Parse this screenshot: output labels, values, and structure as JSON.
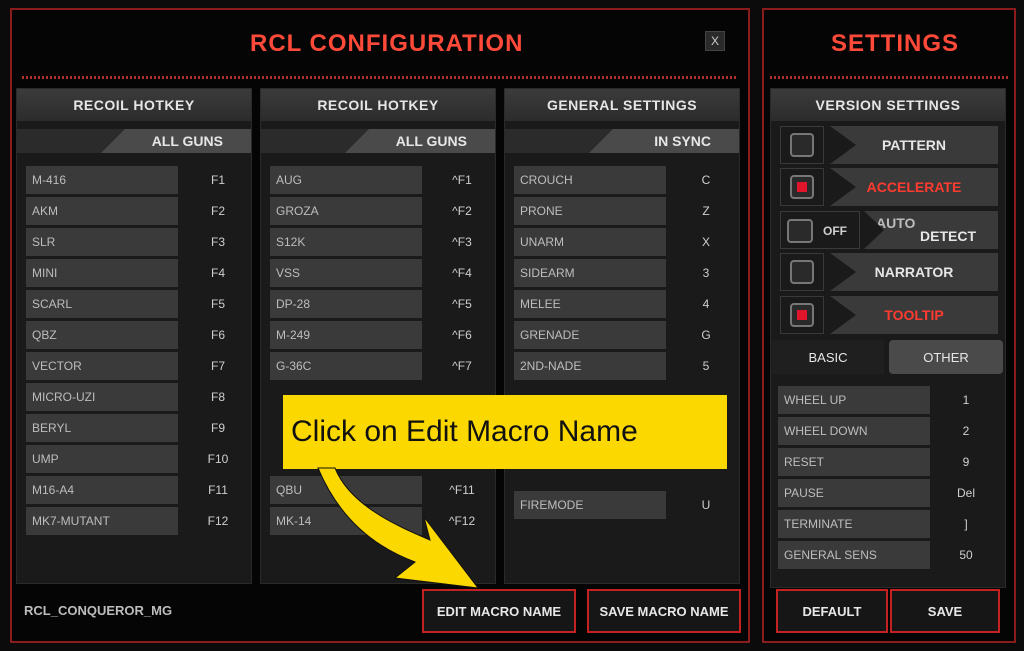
{
  "main": {
    "title": "RCL  CONFIGURATION",
    "close_label": "X",
    "profile_name": "RCL_CONQUEROR_MG",
    "edit_macro_label": "EDIT MACRO NAME",
    "save_macro_label": "SAVE MACRO NAME"
  },
  "col1": {
    "header": "RECOIL HOTKEY",
    "tab": "ALL GUNS",
    "rows": [
      {
        "name": "M-416",
        "key": "F1"
      },
      {
        "name": "AKM",
        "key": "F2"
      },
      {
        "name": "SLR",
        "key": "F3"
      },
      {
        "name": "MINI",
        "key": "F4"
      },
      {
        "name": "SCARL",
        "key": "F5"
      },
      {
        "name": "QBZ",
        "key": "F6"
      },
      {
        "name": "VECTOR",
        "key": "F7"
      },
      {
        "name": "MICRO-UZI",
        "key": "F8"
      },
      {
        "name": "BERYL",
        "key": "F9"
      },
      {
        "name": "UMP",
        "key": "F10"
      },
      {
        "name": "M16-A4",
        "key": "F11"
      },
      {
        "name": "MK7-MUTANT",
        "key": "F12"
      }
    ]
  },
  "col2": {
    "header": "RECOIL HOTKEY",
    "tab": "ALL GUNS",
    "rows": [
      {
        "name": "AUG",
        "key": "^F1"
      },
      {
        "name": "GROZA",
        "key": "^F2"
      },
      {
        "name": "S12K",
        "key": "^F3"
      },
      {
        "name": "VSS",
        "key": "^F4"
      },
      {
        "name": "DP-28",
        "key": "^F5"
      },
      {
        "name": "M-249",
        "key": "^F6"
      },
      {
        "name": "G-36C",
        "key": "^F7"
      },
      {
        "name": "QBU",
        "key": "^F11"
      },
      {
        "name": "MK-14",
        "key": "^F12"
      }
    ]
  },
  "col3": {
    "header": "GENERAL SETTINGS",
    "tab": "IN SYNC",
    "rows": [
      {
        "name": "CROUCH",
        "key": "C"
      },
      {
        "name": "PRONE",
        "key": "Z"
      },
      {
        "name": "UNARM",
        "key": "X"
      },
      {
        "name": "SIDEARM",
        "key": "3"
      },
      {
        "name": "MELEE",
        "key": "4"
      },
      {
        "name": "GRENADE",
        "key": "G"
      },
      {
        "name": "2ND-NADE",
        "key": "5"
      },
      {
        "name": "FIREMODE",
        "key": "U"
      }
    ]
  },
  "settings": {
    "title": "SETTINGS",
    "version_header": "VERSION SETTINGS",
    "pattern_label": "PATTERN",
    "accelerate_label": "ACCELERATE",
    "toggle_label": "OFF",
    "auto_label": "AUTO",
    "detect_label": "DETECT",
    "narrator_label": "NARRATOR",
    "tooltip_label": "TOOLTIP",
    "tab_basic": "BASIC",
    "tab_other": "OTHER",
    "rows": [
      {
        "name": "WHEEL UP",
        "val": "1"
      },
      {
        "name": "WHEEL DOWN",
        "val": "2"
      },
      {
        "name": "RESET",
        "val": "9"
      },
      {
        "name": "PAUSE",
        "val": "Del"
      },
      {
        "name": "TERMINATE",
        "val": "]"
      },
      {
        "name": "GENERAL SENS",
        "val": "50"
      }
    ],
    "default_label": "DEFAULT",
    "save_label": "SAVE"
  },
  "callout": {
    "text": "Click on Edit Macro Name"
  },
  "colors": {
    "accent_red": "#ff4a3a",
    "callout_yellow": "#fbd800"
  }
}
